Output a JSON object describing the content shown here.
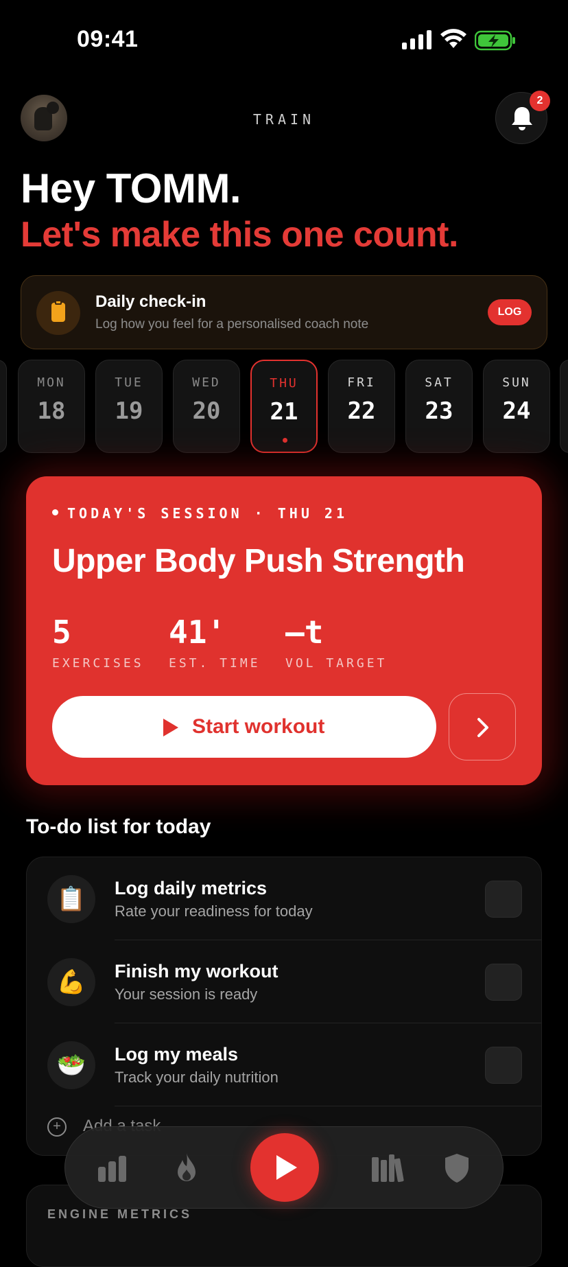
{
  "status_bar": {
    "time": "09:41"
  },
  "header": {
    "screen_title": "TRAIN",
    "notification_count": "2"
  },
  "greeting": {
    "line1": "Hey TOMM.",
    "line2": "Let's make this one count."
  },
  "checkin": {
    "title": "Daily check-in",
    "subtitle": "Log how you feel for a personalised coach note",
    "button": "LOG"
  },
  "days": [
    {
      "name": "MON",
      "date": "18"
    },
    {
      "name": "TUE",
      "date": "19"
    },
    {
      "name": "WED",
      "date": "20"
    },
    {
      "name": "THU",
      "date": "21"
    },
    {
      "name": "FRI",
      "date": "22"
    },
    {
      "name": "SAT",
      "date": "23"
    },
    {
      "name": "SUN",
      "date": "24"
    }
  ],
  "session": {
    "label": "TODAY'S SESSION · THU 21",
    "title": "Upper Body Push Strength",
    "stats": [
      {
        "value": "5",
        "label": "EXERCISES"
      },
      {
        "value": "41'",
        "label": "EST. TIME"
      },
      {
        "value": "—t",
        "label": "VOL TARGET"
      }
    ],
    "start_button": "Start workout"
  },
  "todo": {
    "heading": "To-do list for today",
    "items": [
      {
        "icon": "📋",
        "title": "Log daily metrics",
        "subtitle": "Rate your readiness for today"
      },
      {
        "icon": "💪",
        "title": "Finish my workout",
        "subtitle": "Your session is ready"
      },
      {
        "icon": "🥗",
        "title": "Log my meals",
        "subtitle": "Track your daily nutrition"
      }
    ],
    "add_task": "Add a task"
  },
  "engine": {
    "label": "ENGINE METRICS"
  },
  "colors": {
    "accent": "#e3322f",
    "background": "#000000",
    "checkin_accent": "#f2a21b"
  },
  "nav": {
    "items": [
      "stats-icon",
      "flame-icon",
      "play-icon",
      "library-icon",
      "shield-icon"
    ]
  }
}
